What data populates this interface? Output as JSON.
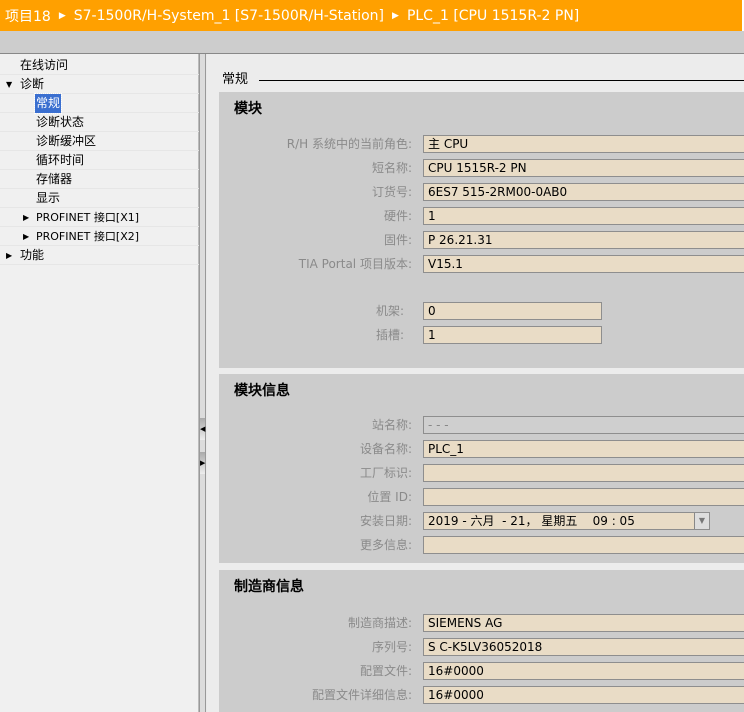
{
  "header": {
    "crumbs": [
      "项目18",
      "S7-1500R/H-System_1 [S7-1500R/H-Station]",
      "PLC_1 [CPU 1515R-2 PN]"
    ]
  },
  "tree": {
    "items": [
      {
        "label": "在线访问",
        "toggle": ""
      },
      {
        "label": "诊断",
        "toggle": "▼"
      },
      {
        "label": "常规",
        "toggle": ""
      },
      {
        "label": "诊断状态",
        "toggle": ""
      },
      {
        "label": "诊断缓冲区",
        "toggle": ""
      },
      {
        "label": "循环时间",
        "toggle": ""
      },
      {
        "label": "存储器",
        "toggle": ""
      },
      {
        "label": "显示",
        "toggle": ""
      },
      {
        "label": "PROFINET 接口[X1]",
        "toggle": "▶"
      },
      {
        "label": "PROFINET 接口[X2]",
        "toggle": "▶"
      },
      {
        "label": "功能",
        "toggle": "▶"
      }
    ]
  },
  "page": {
    "title": "常规"
  },
  "module": {
    "title": "模块",
    "rows": [
      {
        "label": "R/H 系统中的当前角色:",
        "value": "主 CPU"
      },
      {
        "label": "短名称:",
        "value": "CPU 1515R-2 PN"
      },
      {
        "label": "订货号:",
        "value": "6ES7 515-2RM00-0AB0"
      },
      {
        "label": "硬件:",
        "value": "1"
      },
      {
        "label": "固件:",
        "value": "P 26.21.31"
      },
      {
        "label": "TIA Portal 项目版本:",
        "value": "V15.1"
      },
      {
        "label": "机架:",
        "value": "0"
      },
      {
        "label": "插槽:",
        "value": "1"
      }
    ]
  },
  "module_info": {
    "title": "模块信息",
    "rows": [
      {
        "label": "站名称:",
        "value": "- - -"
      },
      {
        "label": "设备名称:",
        "value": "PLC_1"
      },
      {
        "label": "工厂标识:",
        "value": ""
      },
      {
        "label": "位置 ID:",
        "value": ""
      },
      {
        "label": "安装日期:",
        "value": "2019 - 六月  - 21， 星期五    09 : 05"
      },
      {
        "label": "更多信息:",
        "value": ""
      }
    ]
  },
  "manufacturer": {
    "title": "制造商信息",
    "rows": [
      {
        "label": "制造商描述:",
        "value": "SIEMENS AG"
      },
      {
        "label": "序列号:",
        "value": "S C-K5LV36052018"
      },
      {
        "label": "配置文件:",
        "value": "16#0000"
      },
      {
        "label": "配置文件详细信息:",
        "value": "16#0000"
      }
    ]
  }
}
